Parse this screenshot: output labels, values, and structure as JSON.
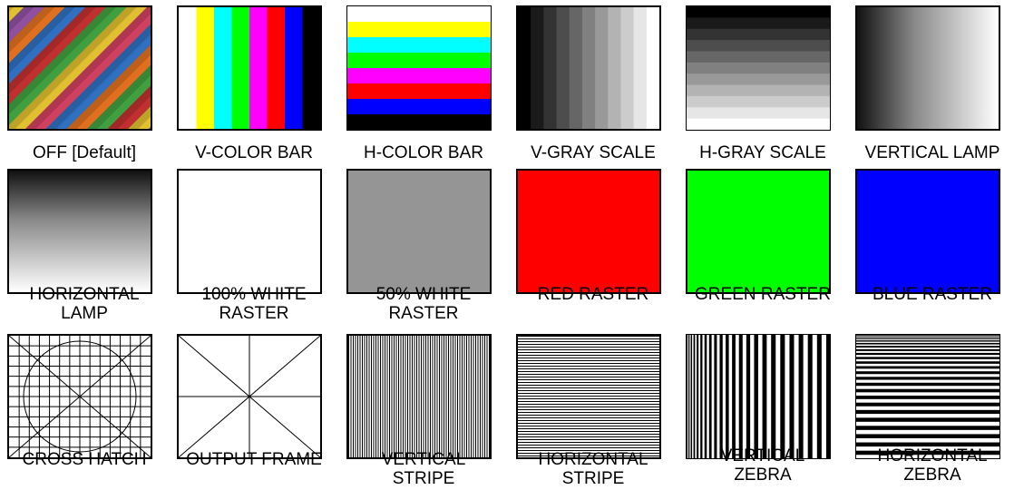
{
  "patterns": [
    {
      "label_lines": [
        "OFF  [Default]"
      ]
    },
    {
      "label_lines": [
        "V-COLOR BAR"
      ]
    },
    {
      "label_lines": [
        "H-COLOR BAR"
      ]
    },
    {
      "label_lines": [
        "V-GRAY SCALE"
      ]
    },
    {
      "label_lines": [
        "H-GRAY SCALE"
      ]
    },
    {
      "label_lines": [
        "VERTICAL LAMP"
      ]
    },
    {
      "label_lines": [
        "HORIZONTAL",
        "LAMP"
      ]
    },
    {
      "label_lines": [
        "100% WHITE",
        "RASTER"
      ]
    },
    {
      "label_lines": [
        "50% WHITE",
        "RASTER"
      ]
    },
    {
      "label_lines": [
        "RED RASTER"
      ]
    },
    {
      "label_lines": [
        "GREEN RASTER"
      ]
    },
    {
      "label_lines": [
        "BLUE RASTER"
      ]
    },
    {
      "label_lines": [
        "CROSS HATCH"
      ]
    },
    {
      "label_lines": [
        "OUTPUT FRAME"
      ]
    },
    {
      "label_lines": [
        "VERTICAL",
        "STRIPE"
      ]
    },
    {
      "label_lines": [
        "HORIZONTAL",
        "STRIPE"
      ]
    },
    {
      "label_lines": [
        "VERTICAL",
        "ZEBRA"
      ]
    },
    {
      "label_lines": [
        "HORIZONTAL",
        "ZEBRA"
      ]
    }
  ],
  "colors": {
    "bars": [
      "#ffffff",
      "#ffff00",
      "#00ffff",
      "#00ff00",
      "#ff00ff",
      "#ff0000",
      "#0000ff",
      "#000000"
    ],
    "half_white": "#959595",
    "red": "#ff0000",
    "green": "#00ff00",
    "blue": "#0000ff"
  }
}
